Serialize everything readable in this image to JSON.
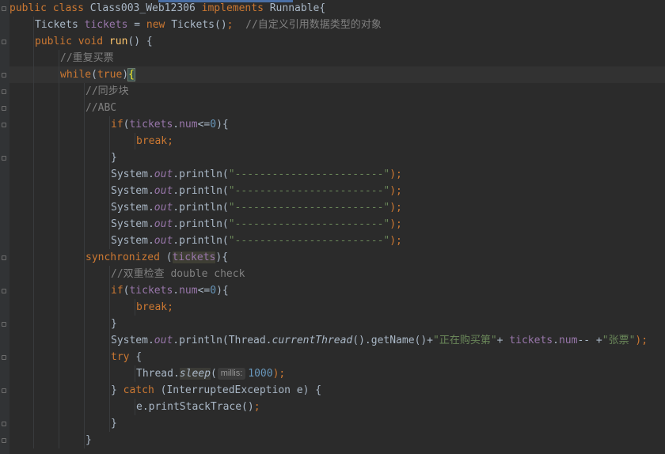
{
  "editor": {
    "lines": [
      {
        "indent": 0,
        "fold": true,
        "tokens": [
          {
            "t": "public class ",
            "c": "kw"
          },
          {
            "t": "Class003_Web12306 ",
            "c": "ident"
          },
          {
            "t": "implements ",
            "c": "kw"
          },
          {
            "t": "Runnable{",
            "c": "ident"
          }
        ]
      },
      {
        "indent": 1,
        "fold": false,
        "tokens": [
          {
            "t": "Tickets ",
            "c": "ident"
          },
          {
            "t": "tickets",
            "c": "field"
          },
          {
            "t": " = ",
            "c": "ident"
          },
          {
            "t": "new ",
            "c": "kw"
          },
          {
            "t": "Tickets()",
            "c": "ident"
          },
          {
            "t": ";  ",
            "c": "kw"
          },
          {
            "t": "//自定义引用数据类型的对象",
            "c": "cmt"
          }
        ]
      },
      {
        "indent": 1,
        "fold": true,
        "tokens": [
          {
            "t": "public void ",
            "c": "kw"
          },
          {
            "t": "run",
            "c": "fn"
          },
          {
            "t": "() {",
            "c": "ident"
          }
        ]
      },
      {
        "indent": 2,
        "fold": false,
        "tokens": [
          {
            "t": "//重复买票",
            "c": "cmt"
          }
        ]
      },
      {
        "indent": 2,
        "fold": true,
        "current": true,
        "tokens": [
          {
            "t": "while",
            "c": "kw"
          },
          {
            "t": "(",
            "c": "ident"
          },
          {
            "t": "true",
            "c": "kw"
          },
          {
            "t": ")",
            "c": "ident"
          },
          {
            "t": "{",
            "c": "brace-match"
          }
        ]
      },
      {
        "indent": 3,
        "fold": true,
        "tokens": [
          {
            "t": "//同步块",
            "c": "cmt"
          }
        ]
      },
      {
        "indent": 3,
        "fold": true,
        "tokens": [
          {
            "t": "//ABC",
            "c": "cmt"
          }
        ]
      },
      {
        "indent": 4,
        "fold": true,
        "tokens": [
          {
            "t": "if",
            "c": "kw"
          },
          {
            "t": "(",
            "c": "ident"
          },
          {
            "t": "tickets",
            "c": "field"
          },
          {
            "t": ".",
            "c": "ident"
          },
          {
            "t": "num",
            "c": "field"
          },
          {
            "t": "<=",
            "c": "ident"
          },
          {
            "t": "0",
            "c": "num"
          },
          {
            "t": "){",
            "c": "ident"
          }
        ]
      },
      {
        "indent": 5,
        "fold": false,
        "tokens": [
          {
            "t": "break;",
            "c": "kw"
          }
        ]
      },
      {
        "indent": 4,
        "fold": true,
        "tokens": [
          {
            "t": "}",
            "c": "ident"
          }
        ]
      },
      {
        "indent": 4,
        "fold": false,
        "tokens": [
          {
            "t": "System.",
            "c": "ident"
          },
          {
            "t": "out",
            "c": "static"
          },
          {
            "t": ".println(",
            "c": "ident"
          },
          {
            "t": "\"------------------------\"",
            "c": "str"
          },
          {
            "t": ");",
            "c": "kw"
          }
        ]
      },
      {
        "indent": 4,
        "fold": false,
        "tokens": [
          {
            "t": "System.",
            "c": "ident"
          },
          {
            "t": "out",
            "c": "static"
          },
          {
            "t": ".println(",
            "c": "ident"
          },
          {
            "t": "\"------------------------\"",
            "c": "str"
          },
          {
            "t": ");",
            "c": "kw"
          }
        ]
      },
      {
        "indent": 4,
        "fold": false,
        "tokens": [
          {
            "t": "System.",
            "c": "ident"
          },
          {
            "t": "out",
            "c": "static"
          },
          {
            "t": ".println(",
            "c": "ident"
          },
          {
            "t": "\"------------------------\"",
            "c": "str"
          },
          {
            "t": ");",
            "c": "kw"
          }
        ]
      },
      {
        "indent": 4,
        "fold": false,
        "tokens": [
          {
            "t": "System.",
            "c": "ident"
          },
          {
            "t": "out",
            "c": "static"
          },
          {
            "t": ".println(",
            "c": "ident"
          },
          {
            "t": "\"------------------------\"",
            "c": "str"
          },
          {
            "t": ");",
            "c": "kw"
          }
        ]
      },
      {
        "indent": 4,
        "fold": false,
        "tokens": [
          {
            "t": "System.",
            "c": "ident"
          },
          {
            "t": "out",
            "c": "static"
          },
          {
            "t": ".println(",
            "c": "ident"
          },
          {
            "t": "\"------------------------\"",
            "c": "str"
          },
          {
            "t": ");",
            "c": "kw"
          }
        ]
      },
      {
        "indent": 3,
        "fold": true,
        "tokens": [
          {
            "t": "synchronized ",
            "c": "kw"
          },
          {
            "t": "(",
            "c": "ident"
          },
          {
            "t": "tickets",
            "c": "field hlsync"
          },
          {
            "t": "){",
            "c": "ident"
          }
        ]
      },
      {
        "indent": 4,
        "fold": false,
        "tokens": [
          {
            "t": "//双重检查 double check",
            "c": "cmt"
          }
        ]
      },
      {
        "indent": 4,
        "fold": true,
        "tokens": [
          {
            "t": "if",
            "c": "kw"
          },
          {
            "t": "(",
            "c": "ident"
          },
          {
            "t": "tickets",
            "c": "field"
          },
          {
            "t": ".",
            "c": "ident"
          },
          {
            "t": "num",
            "c": "field"
          },
          {
            "t": "<=",
            "c": "ident"
          },
          {
            "t": "0",
            "c": "num"
          },
          {
            "t": "){",
            "c": "ident"
          }
        ]
      },
      {
        "indent": 5,
        "fold": false,
        "tokens": [
          {
            "t": "break;",
            "c": "kw"
          }
        ]
      },
      {
        "indent": 4,
        "fold": true,
        "tokens": [
          {
            "t": "}",
            "c": "ident"
          }
        ]
      },
      {
        "indent": 4,
        "fold": false,
        "tokens": [
          {
            "t": "System.",
            "c": "ident"
          },
          {
            "t": "out",
            "c": "static"
          },
          {
            "t": ".println(Thread.",
            "c": "ident"
          },
          {
            "t": "currentThread",
            "c": "staticm"
          },
          {
            "t": "().getName()+",
            "c": "ident"
          },
          {
            "t": "\"正在购买第\"",
            "c": "str"
          },
          {
            "t": "+ ",
            "c": "ident"
          },
          {
            "t": "tickets",
            "c": "field"
          },
          {
            "t": ".",
            "c": "ident"
          },
          {
            "t": "num",
            "c": "field"
          },
          {
            "t": "-- +",
            "c": "ident"
          },
          {
            "t": "\"张票\"",
            "c": "str"
          },
          {
            "t": ");",
            "c": "kw"
          }
        ]
      },
      {
        "indent": 4,
        "fold": true,
        "tokens": [
          {
            "t": "try ",
            "c": "kw"
          },
          {
            "t": "{",
            "c": "ident"
          }
        ]
      },
      {
        "indent": 5,
        "fold": false,
        "tokens": [
          {
            "t": "Thread.",
            "c": "ident"
          },
          {
            "t": "sleep",
            "c": "staticm hl"
          },
          {
            "t": "(",
            "c": "ident"
          },
          {
            "t": "millis:",
            "c": "hint"
          },
          {
            "t": "1000",
            "c": "num"
          },
          {
            "t": ");",
            "c": "kw"
          }
        ]
      },
      {
        "indent": 4,
        "fold": true,
        "tokens": [
          {
            "t": "} ",
            "c": "ident"
          },
          {
            "t": "catch ",
            "c": "kw"
          },
          {
            "t": "(InterruptedException e) {",
            "c": "ident"
          }
        ]
      },
      {
        "indent": 5,
        "fold": false,
        "tokens": [
          {
            "t": "e.printStackTrace()",
            "c": "ident"
          },
          {
            "t": ";",
            "c": "kw"
          }
        ]
      },
      {
        "indent": 4,
        "fold": true,
        "tokens": [
          {
            "t": "}",
            "c": "ident"
          }
        ]
      },
      {
        "indent": 3,
        "fold": true,
        "tokens": [
          {
            "t": "}",
            "c": "ident"
          }
        ]
      }
    ]
  },
  "colors": {
    "background": "#2b2b2b",
    "keyword": "#cc7832",
    "field": "#9876aa",
    "string": "#6a8759",
    "number": "#6897bb",
    "comment": "#808080",
    "method": "#ffc66d",
    "text": "#a9b7c6"
  }
}
